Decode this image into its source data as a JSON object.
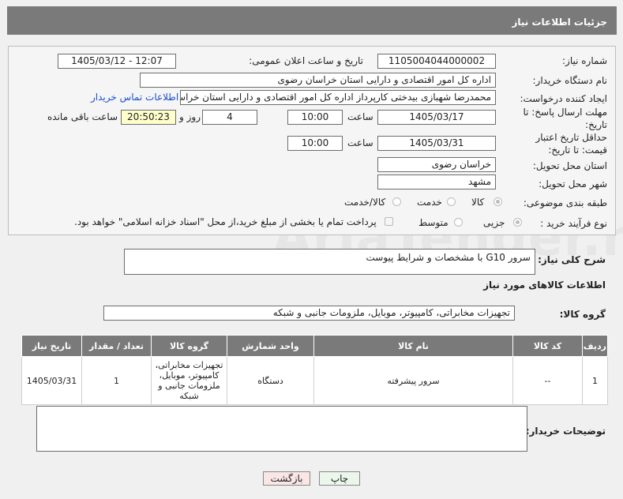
{
  "header": {
    "title": "جزئیات اطلاعات نیاز"
  },
  "watermark": "AriaTender.net",
  "form": {
    "need_number_label": "شماره نیاز:",
    "need_number": "1105004044000002",
    "announce_label": "تاریخ و ساعت اعلان عمومی:",
    "announce_value": "1405/03/12 - 12:07",
    "buyer_org_label": "نام دستگاه خریدار:",
    "buyer_org": "اداره کل امور اقتصادی و دارایی استان خراسان رضوی",
    "creator_label": "ایجاد کننده درخواست:",
    "creator": "محمدرضا شهبازی بیدختی کارپرداز اداره کل امور اقتصادی و دارایی استان خراسان رضوی",
    "contact_link": "اطلاعات تماس خریدار",
    "reply_deadline_label": "مهلت ارسال پاسخ: تا تاریخ:",
    "reply_date": "1405/03/17",
    "time_label": "ساعت",
    "reply_time": "10:00",
    "days_value": "4",
    "days_label": "روز و",
    "remaining_time": "20:50:23",
    "remaining_label": "ساعت باقی مانده",
    "validity_label": "حداقل تاریخ اعتبار قیمت: تا تاریخ:",
    "validity_date": "1405/03/31",
    "validity_time_label": "ساعت",
    "validity_time": "10:00",
    "province_label": "استان محل تحویل:",
    "province": "خراسان رضوی",
    "city_label": "شهر محل تحویل:",
    "city": "مشهد",
    "category_label": "طبقه بندی موضوعی:",
    "category_options": [
      "کالا",
      "خدمت",
      "کالا/خدمت"
    ],
    "process_label": "نوع فرآیند خرید :",
    "process_options": [
      "جزیی",
      "متوسط"
    ],
    "payment_note": "پرداخت تمام یا بخشی از مبلغ خرید،از محل \"اسناد خزانه اسلامی\" خواهد بود."
  },
  "description": {
    "label": "شرح کلی نیاز:",
    "value": "سرور G10  با مشخصات و شرایط پیوست"
  },
  "goods_info": {
    "title": "اطلاعات کالاهای مورد نیاز",
    "group_label": "گروه کالا:",
    "group_value": "تجهیزات مخابراتی، کامپیوتر، موبایل، ملزومات جانبی و شبکه"
  },
  "table": {
    "headers": [
      "ردیف",
      "کد کالا",
      "نام کالا",
      "واحد شمارش",
      "گروه کالا",
      "تعداد / مقدار",
      "تاریخ نیاز"
    ],
    "rows": [
      {
        "row": "1",
        "code": "--",
        "name": "سرور پیشرفته",
        "unit": "دستگاه",
        "group": "تجهیزات مخابراتی، کامپیوتر، موبایل، ملزومات جانبی و شبکه",
        "qty": "1",
        "date": "1405/03/31"
      }
    ]
  },
  "buyer_notes": {
    "label": "توضیحات خریدار:",
    "value": ""
  },
  "buttons": {
    "print": "چاپ",
    "back": "بازگشت"
  }
}
